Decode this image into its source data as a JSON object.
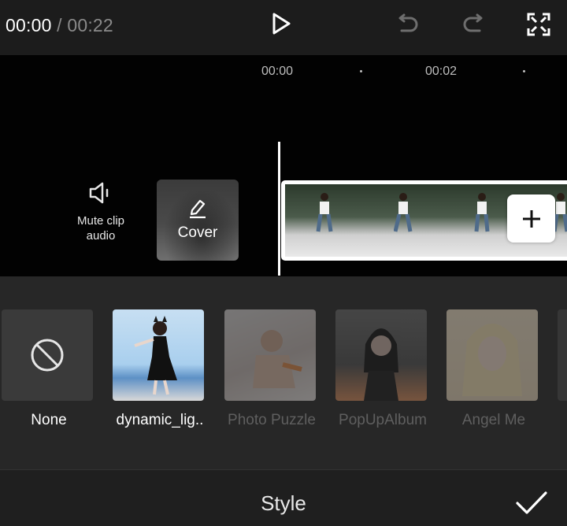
{
  "player": {
    "current_time": "00:00",
    "separator": "/",
    "duration": "00:22"
  },
  "icons": {
    "play": "play-icon",
    "undo": "undo-icon",
    "redo": "redo-icon",
    "fullscreen": "fullscreen-icon",
    "mute": "speaker-icon",
    "cover_edit": "pencil-icon",
    "add_clip": "plus-icon",
    "none": "prohibited-icon",
    "confirm": "checkmark-icon"
  },
  "timeline": {
    "ticks": [
      "00:00",
      "00:02"
    ],
    "mute_label": "Mute clip audio",
    "cover_label": "Cover"
  },
  "styles": {
    "items": [
      {
        "name": "None",
        "state": "enabled"
      },
      {
        "name": "dynamic_lig..",
        "state": "enabled"
      },
      {
        "name": "Photo Puzzle",
        "state": "disabled"
      },
      {
        "name": "PopUpAlbum",
        "state": "disabled"
      },
      {
        "name": "Angel Me",
        "state": "disabled"
      }
    ]
  },
  "bottom": {
    "title": "Style"
  },
  "colors": {
    "background": "#1e1e1e",
    "timeline_bg": "#020202",
    "panel_bg": "#272727",
    "accent": "#ffffff",
    "muted_text": "#8a8a8a"
  }
}
